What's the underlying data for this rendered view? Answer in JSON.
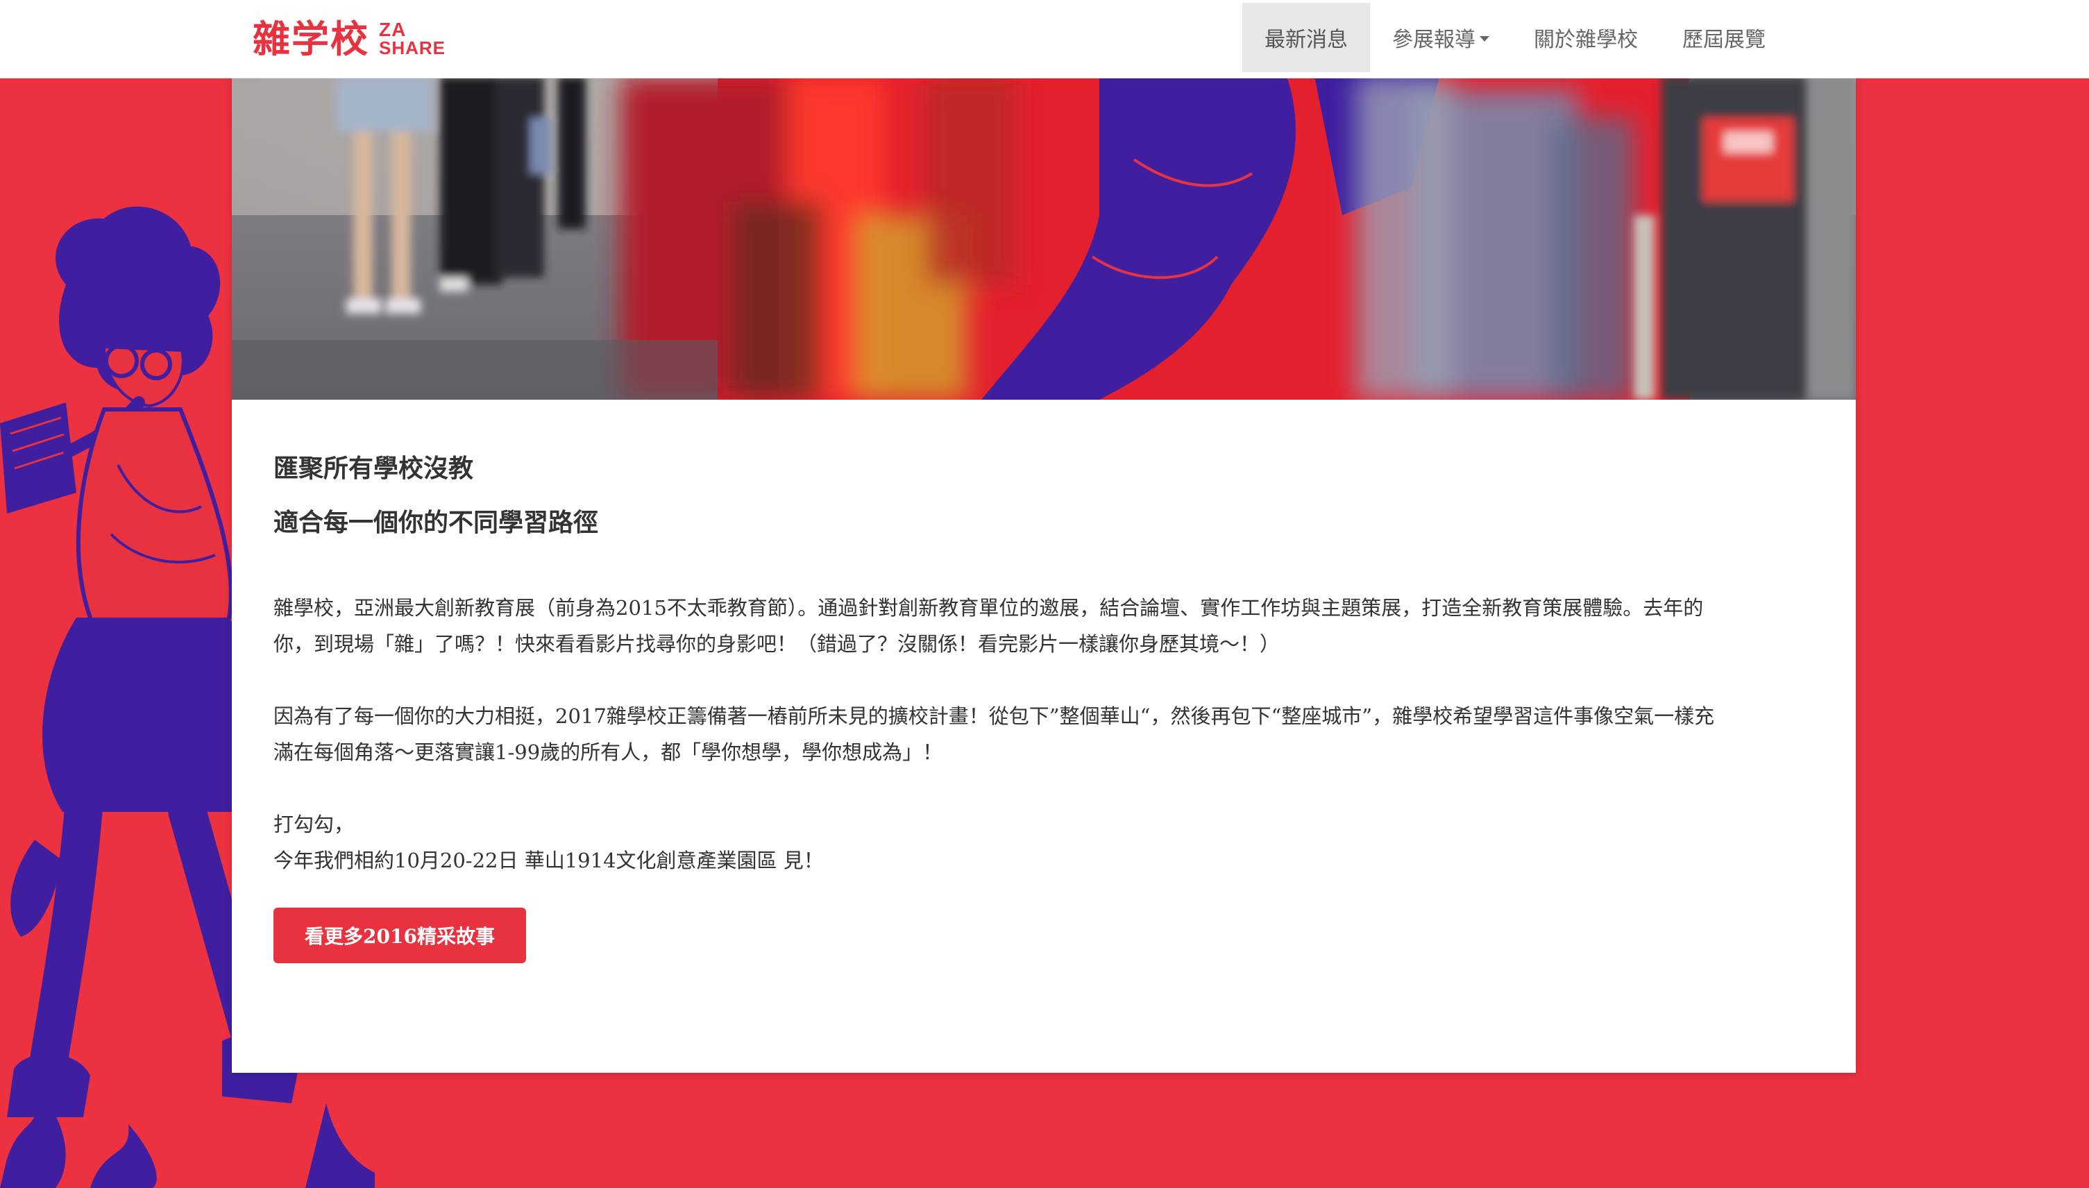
{
  "brand": {
    "name_cjk": "雜学校",
    "name_latin_line1": "ZA",
    "name_latin_line2": "SHARE"
  },
  "nav": {
    "items": [
      {
        "label": "最新消息",
        "active": true
      },
      {
        "label": "參展報導",
        "has_dropdown": true
      },
      {
        "label": "關於雜學校"
      },
      {
        "label": "歷屆展覽"
      }
    ]
  },
  "article": {
    "headline_1": "匯聚所有學校沒教",
    "headline_2": "適合每一個你的不同學習路徑",
    "para_1_line_1": "雜學校，亞洲最大創新教育展（前身為2015不太乖教育節）。通過針對創新教育單位的邀展，結合論壇、實作工作坊與主題策展，打造全新教育策展體驗。去年的",
    "para_1_line_2": "你，到現場「雜」了嗎？！快來看看影片找尋你的身影吧！（錯過了？沒關係！看完影片一樣讓你身歷其境～！）",
    "para_2_line_1": "因為有了每一個你的大力相挺，2017雜學校正籌備著一樁前所未見的擴校計畫！從包下”整個華山“，然後再包下“整座城市”，雜學校希望學習這件事像空氣一樣充",
    "para_2_line_2": "滿在每個角落～更落實讓1-99歲的所有人，都「學你想學，學你想成為」！",
    "para_3_line_1": "打勾勾，",
    "para_3_line_2": "今年我們相約10月20-22日 華山1914文化創意產業園區 見！",
    "cta_label": "看更多2016精采故事"
  },
  "colors": {
    "brand_red": "#e8323f",
    "page_background": "#ec3140",
    "illustration_purple": "#3f1fa0"
  },
  "icons": {
    "dropdown": "caret-down-icon"
  }
}
